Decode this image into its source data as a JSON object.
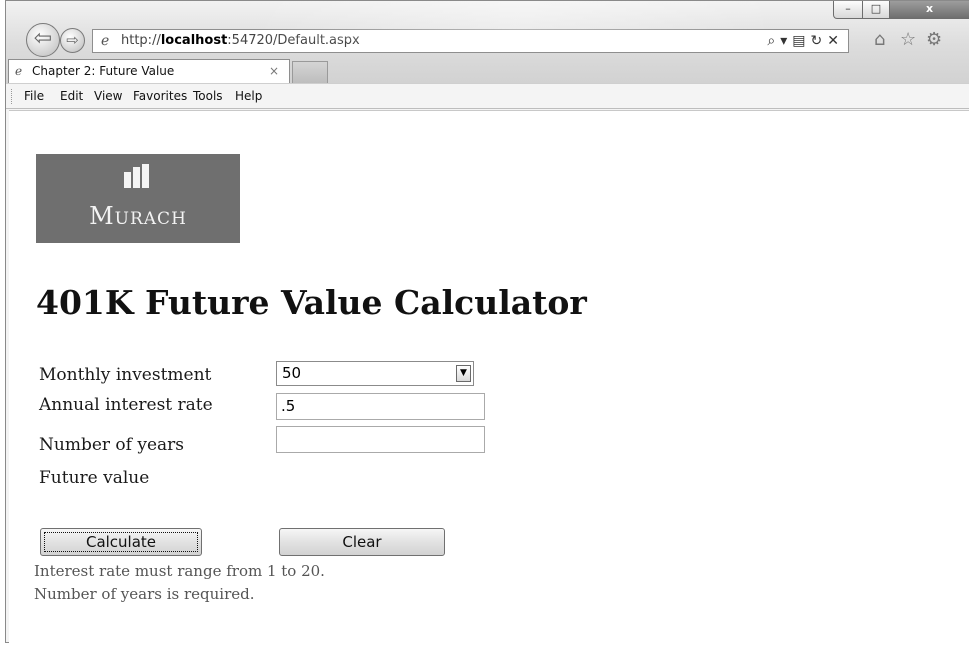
{
  "browser": {
    "address": {
      "url_prefix": "http://",
      "url_host": "localhost",
      "url_rest": ":54720/Default.aspx"
    },
    "tab": {
      "title": "Chapter 2: Future Value",
      "close": "×"
    },
    "menu": [
      "File",
      "Edit",
      "View",
      "Favorites",
      "Tools",
      "Help"
    ],
    "window_controls": {
      "minimize": "–",
      "maximize": "□",
      "close": "x"
    }
  },
  "page": {
    "logo": {
      "word_first": "M",
      "word_rest": "URACH"
    },
    "title": "401K Future Value Calculator",
    "labels": {
      "monthly": "Monthly investment",
      "rate": "Annual interest rate",
      "years": "Number of years",
      "future": "Future value"
    },
    "fields": {
      "monthly_selected": "50",
      "rate_value": ".5",
      "years_value": ""
    },
    "buttons": {
      "calculate": "Calculate",
      "clear": "Clear"
    },
    "errors": [
      "Interest rate must range from 1 to 20.",
      "Number of years is required."
    ]
  }
}
